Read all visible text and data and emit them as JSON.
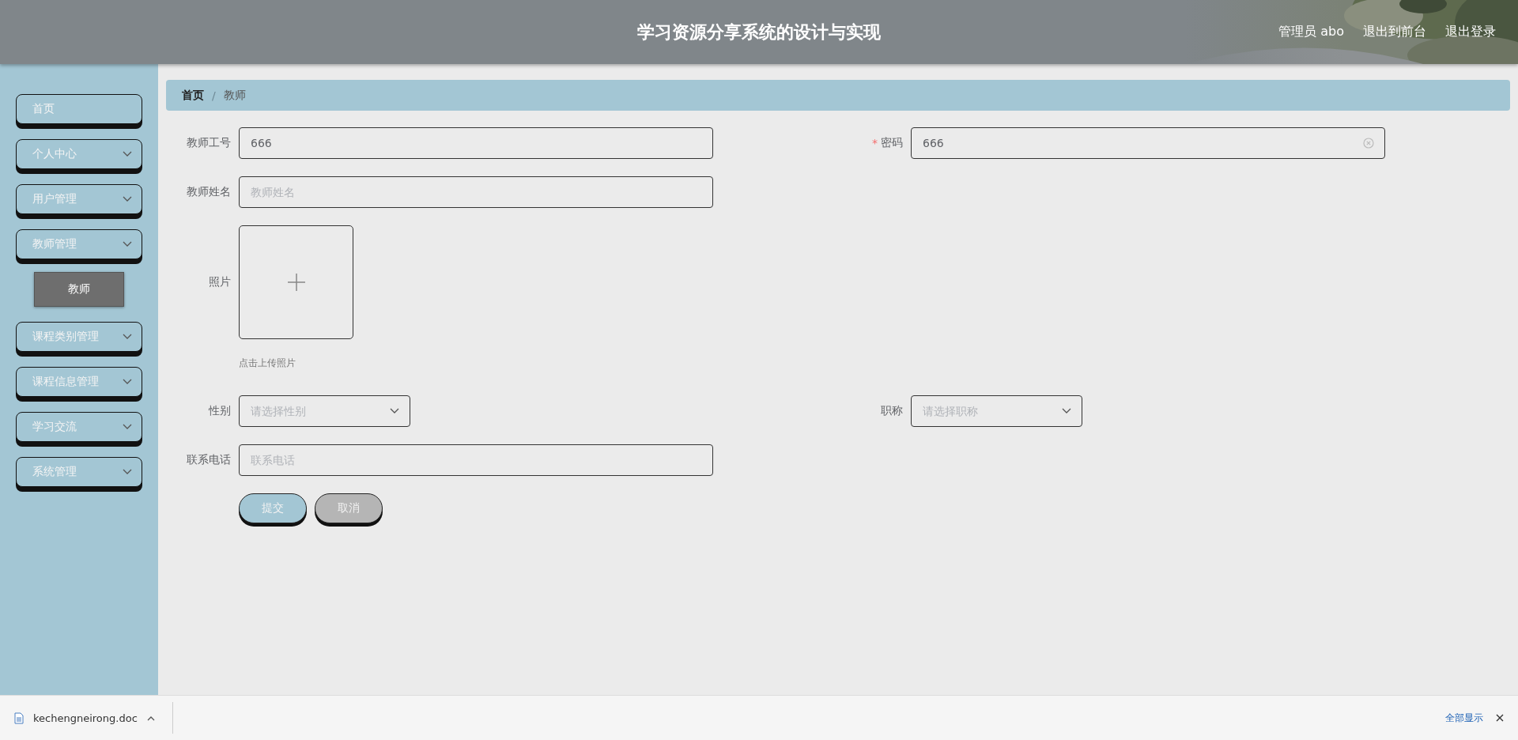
{
  "header": {
    "title": "学习资源分享系统的设计与实现",
    "user": "管理员 abo",
    "links": [
      "退出到前台",
      "退出登录"
    ]
  },
  "sidebar": {
    "items": [
      {
        "label": "首页",
        "expandable": false
      },
      {
        "label": "个人中心",
        "expandable": true
      },
      {
        "label": "用户管理",
        "expandable": true
      },
      {
        "label": "教师管理",
        "expandable": true,
        "children": [
          {
            "label": "教师",
            "selected": true
          }
        ]
      },
      {
        "label": "课程类别管理",
        "expandable": true
      },
      {
        "label": "课程信息管理",
        "expandable": true
      },
      {
        "label": "学习交流",
        "expandable": true
      },
      {
        "label": "系统管理",
        "expandable": true
      }
    ]
  },
  "breadcrumb": {
    "separator": "/",
    "items": [
      "首页",
      "教师"
    ]
  },
  "form": {
    "rows": [
      {
        "fields": [
          {
            "kind": "text",
            "label": "教师工号",
            "value": "666"
          },
          {
            "kind": "password",
            "label": "密码",
            "value": "666",
            "required_mark": "*"
          }
        ]
      },
      {
        "fields": [
          {
            "kind": "text",
            "label": "教师姓名",
            "placeholder": "教师姓名"
          }
        ]
      },
      {
        "fields": [
          {
            "kind": "upload",
            "label": "照片",
            "hint": "点击上传照片"
          }
        ]
      },
      {
        "fields": [
          {
            "kind": "select",
            "label": "性别",
            "placeholder": "请选择性别"
          },
          {
            "kind": "select",
            "label": "职称",
            "placeholder": "请选择职称"
          }
        ]
      },
      {
        "fields": [
          {
            "kind": "text",
            "label": "联系电话",
            "placeholder": "联系电话"
          }
        ]
      }
    ],
    "buttons": [
      {
        "label": "提交",
        "kind": "primary"
      },
      {
        "label": "取消",
        "kind": "secondary"
      }
    ]
  },
  "downloads": {
    "file": "kechengneirong.doc",
    "show_all": "全部显示"
  }
}
